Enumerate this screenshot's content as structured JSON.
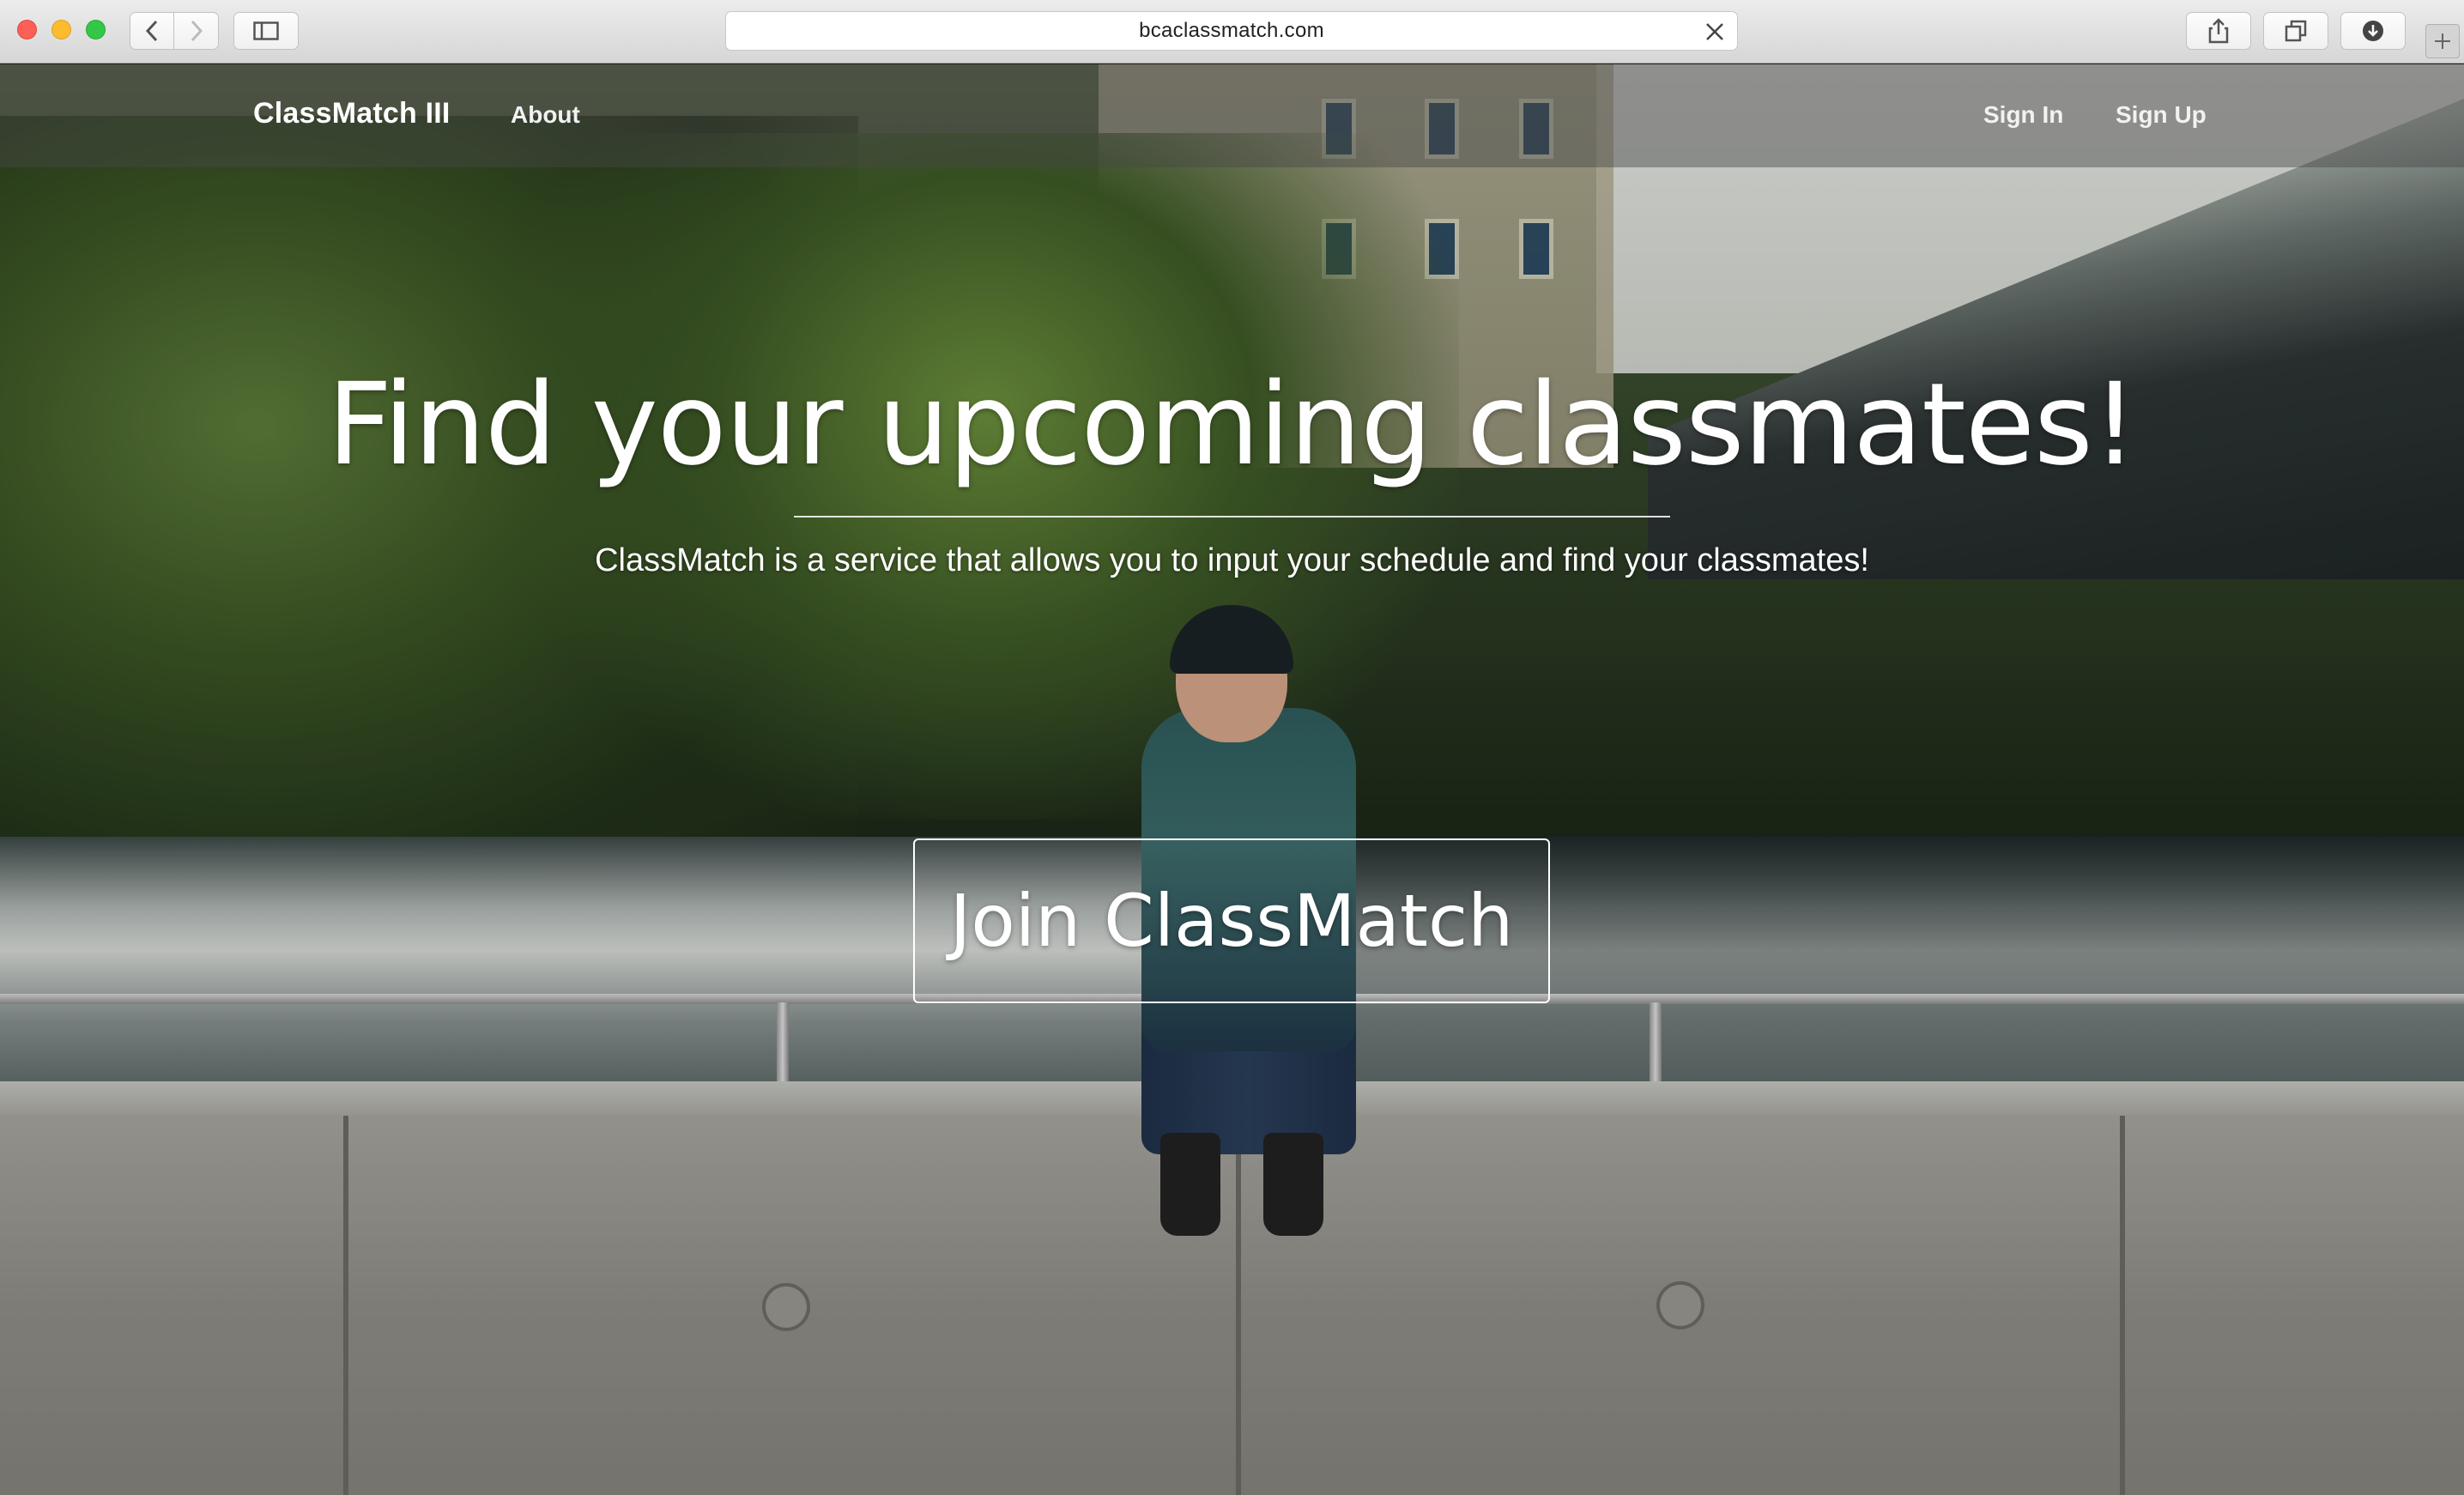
{
  "browser": {
    "url": "bcaclassmatch.com",
    "icons": {
      "back": "chevron-left-icon",
      "forward": "chevron-right-icon",
      "sidebar": "sidebar-icon",
      "clear": "close-icon",
      "share": "share-icon",
      "tabs": "tabs-icon",
      "downloads": "download-icon",
      "new_tab": "plus-icon"
    }
  },
  "navbar": {
    "brand": "ClassMatch III",
    "links": {
      "about": "About",
      "sign_in": "Sign In",
      "sign_up": "Sign Up"
    }
  },
  "hero": {
    "title": "Find your upcoming classmates!",
    "subtitle": "ClassMatch is a service that allows you to input your schedule and find your classmates!",
    "cta_label": "Join ClassMatch"
  },
  "colors": {
    "text": "#ffffff",
    "nav_overlay": "rgba(70,70,70,0.45)",
    "traffic_red": "#fc5f57",
    "traffic_yellow": "#fdbc2e",
    "traffic_green": "#33c748"
  }
}
